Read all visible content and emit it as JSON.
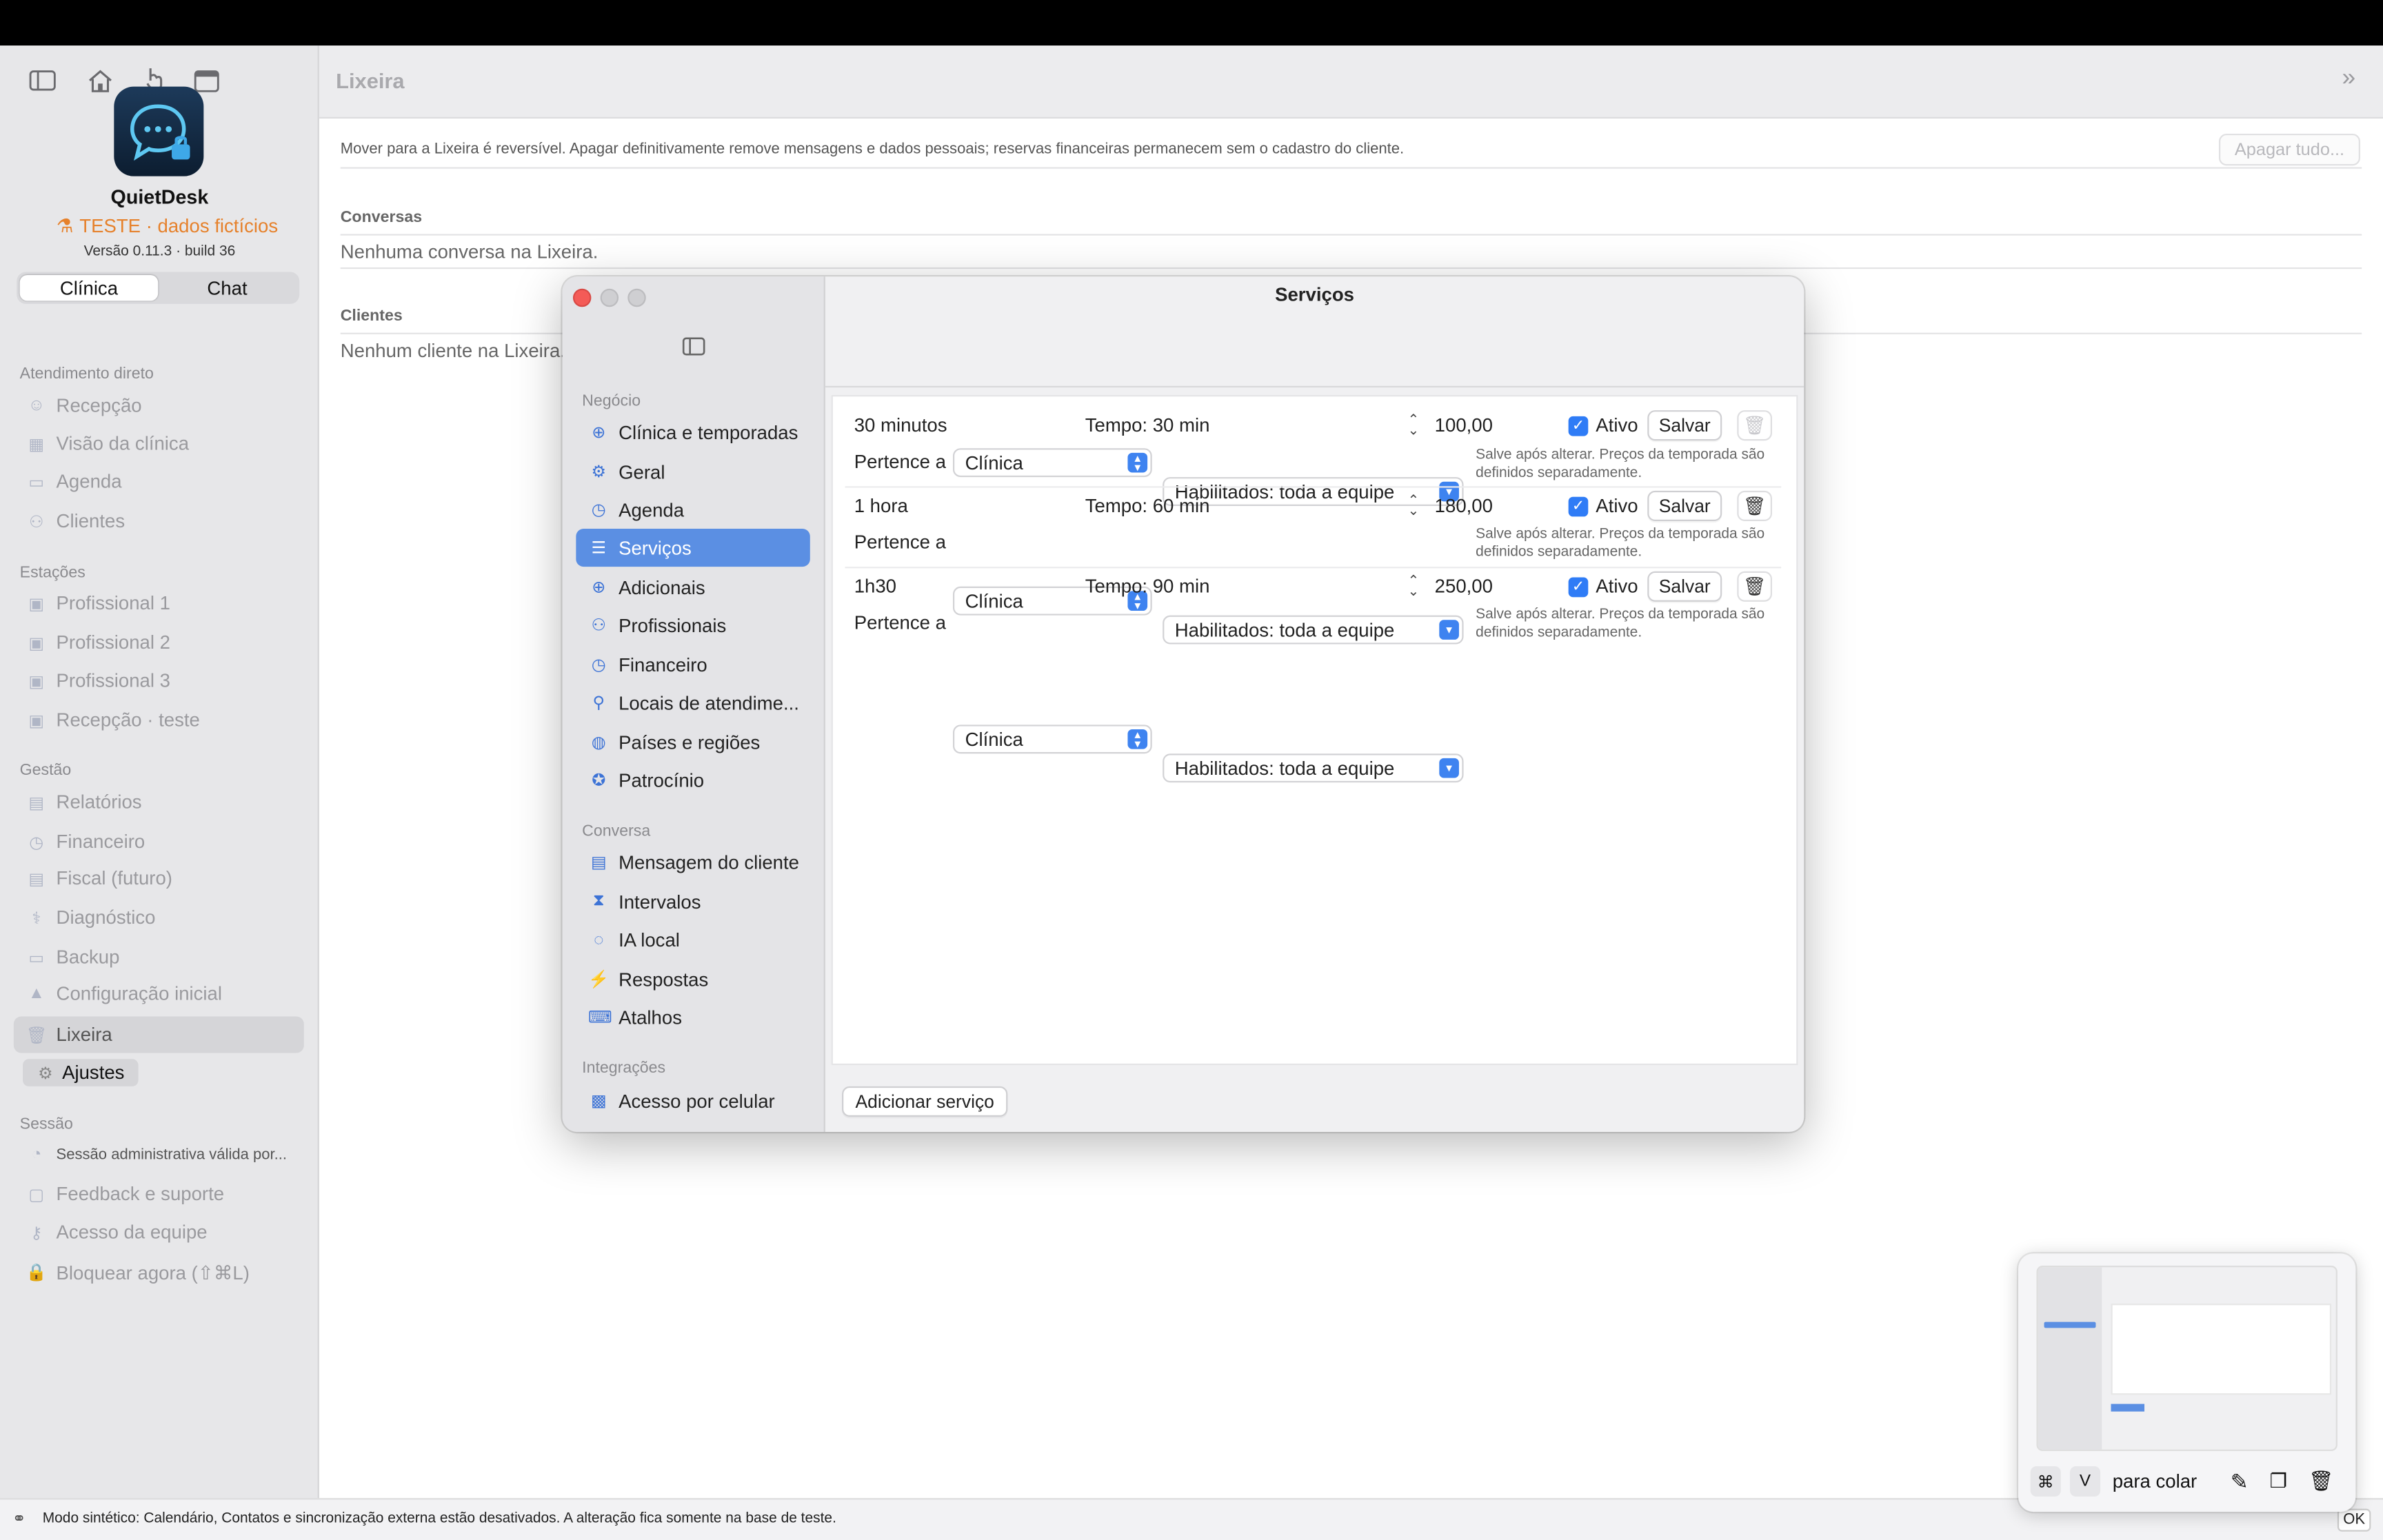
{
  "window": {
    "title": "Lixeira",
    "collapse_icon": "chevron-double-right-icon"
  },
  "toolbar": {
    "icons": [
      "sidebar-toggle-icon",
      "home-icon",
      "hand-pointer-icon",
      "calendar-icon"
    ]
  },
  "sidebar": {
    "app_name": "QuietDesk",
    "test_label": "TESTE · dados fictícios",
    "version": "Versão 0.11.3 · build 36",
    "segments": [
      "Clínica",
      "Chat"
    ],
    "sections": [
      {
        "title": "Atendimento direto",
        "items": [
          "Recepção",
          "Visão da clínica",
          "Agenda",
          "Clientes"
        ]
      },
      {
        "title": "Estações",
        "items": [
          "Profissional 1",
          "Profissional 2",
          "Profissional 3",
          "Recepção · teste"
        ]
      },
      {
        "title": "Gestão",
        "items": [
          "Relatórios",
          "Financeiro",
          "Fiscal (futuro)",
          "Diagnóstico",
          "Backup",
          "Configuração inicial",
          "Lixeira"
        ]
      },
      {
        "title": "Sessão",
        "items": [
          "Sessão administrativa válida por...",
          "Feedback e suporte",
          "Acesso da equipe",
          "Bloquear agora (⇧⌘L)"
        ]
      }
    ],
    "ajustes_label": "Ajustes"
  },
  "main": {
    "notice": "Mover para a Lixeira é reversível. Apagar definitivamente remove mensagens e dados pessoais; reservas financeiras permanecem sem o cadastro do cliente.",
    "apagar_button": "Apagar tudo...",
    "conversas_title": "Conversas",
    "conversas_empty": "Nenhuma conversa na Lixeira.",
    "clientes_title": "Clientes",
    "clientes_empty": "Nenhum cliente na Lixeira."
  },
  "dialog": {
    "title": "Serviços",
    "sections": [
      {
        "title": "Negócio",
        "items": [
          "Clínica e temporadas",
          "Geral",
          "Agenda",
          "Serviços",
          "Adicionais",
          "Profissionais",
          "Financeiro",
          "Locais de atendime...",
          "Países e regiões",
          "Patrocínio"
        ]
      },
      {
        "title": "Conversa",
        "items": [
          "Mensagem do cliente",
          "Intervalos",
          "IA local",
          "Respostas",
          "Atalhos"
        ]
      },
      {
        "title": "Integrações",
        "items": [
          "Acesso por celular"
        ]
      }
    ],
    "services": [
      {
        "name": "30 minutos",
        "tempo": "Tempo: 30 min",
        "price": "100,00",
        "active_label": "Ativo",
        "save": "Salvar",
        "belongs": "Pertence a",
        "scope": "Clínica",
        "staff": "Habilitados: toda a equipe",
        "hint": "Salve após alterar. Preços da temporada são definidos separadamente."
      },
      {
        "name": "1 hora",
        "tempo": "Tempo: 60 min",
        "price": "180,00",
        "active_label": "Ativo",
        "save": "Salvar",
        "belongs": "Pertence a",
        "scope": "Clínica",
        "staff": "Habilitados: toda a equipe",
        "hint": "Salve após alterar. Preços da temporada são definidos separadamente."
      },
      {
        "name": "1h30",
        "tempo": "Tempo: 90 min",
        "price": "250,00",
        "active_label": "Ativo",
        "save": "Salvar",
        "belongs": "Pertence a",
        "scope": "Clínica",
        "staff": "Habilitados: toda a equipe",
        "hint": "Salve após alterar. Preços da temporada são definidos separadamente."
      }
    ],
    "add_button": "Adicionar serviço"
  },
  "clipboard": {
    "key1": "⌘",
    "key2": "V",
    "label": "para colar"
  },
  "status": {
    "text": "Modo sintético: Calendário, Contatos e sincronização externa estão desativados. A alteração fica somente na base de teste.",
    "ok": "OK"
  },
  "colors": {
    "accent": "#5b8fe3",
    "test_orange": "#e6812b",
    "checkbox": "#2f7cf6"
  }
}
